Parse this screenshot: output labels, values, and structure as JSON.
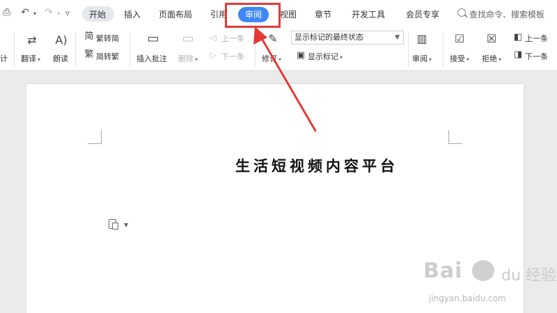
{
  "menubar": {
    "tabs": [
      {
        "label": "开始"
      },
      {
        "label": "插入"
      },
      {
        "label": "页面布局"
      },
      {
        "label": "引用"
      },
      {
        "label": "审阅"
      },
      {
        "label": "视图"
      },
      {
        "label": "章节"
      },
      {
        "label": "开发工具"
      },
      {
        "label": "会员专享"
      }
    ],
    "active_tab": "开始",
    "highlighted_tab": "审阅",
    "search_placeholder": "查找命令、搜索模板"
  },
  "ribbon": {
    "cut_label": "计",
    "translate_label": "翻译",
    "read_label": "朗读",
    "trad_label": "繁转简",
    "simp_label": "简转繁",
    "insert_comment_label": "插入批注",
    "delete_label": "删除",
    "prev_comment_label": "上一条",
    "next_comment_label": "下一条",
    "track_label": "修订",
    "markup_select": "显示标记的最终状态",
    "show_markup_label": "显示标记",
    "review_pane_label": "审阅",
    "accept_label": "接受",
    "reject_label": "拒绝",
    "prev_change_label": "上一条",
    "next_change_label": "下一条"
  },
  "document": {
    "title": "生活短视频内容平台"
  },
  "watermark": {
    "logo": "Bai",
    "logo2": "du",
    "sub": "经验",
    "url": "jingyan.baidu.com"
  },
  "colors": {
    "accent": "#3f87f5",
    "annotation": "#e53935"
  }
}
